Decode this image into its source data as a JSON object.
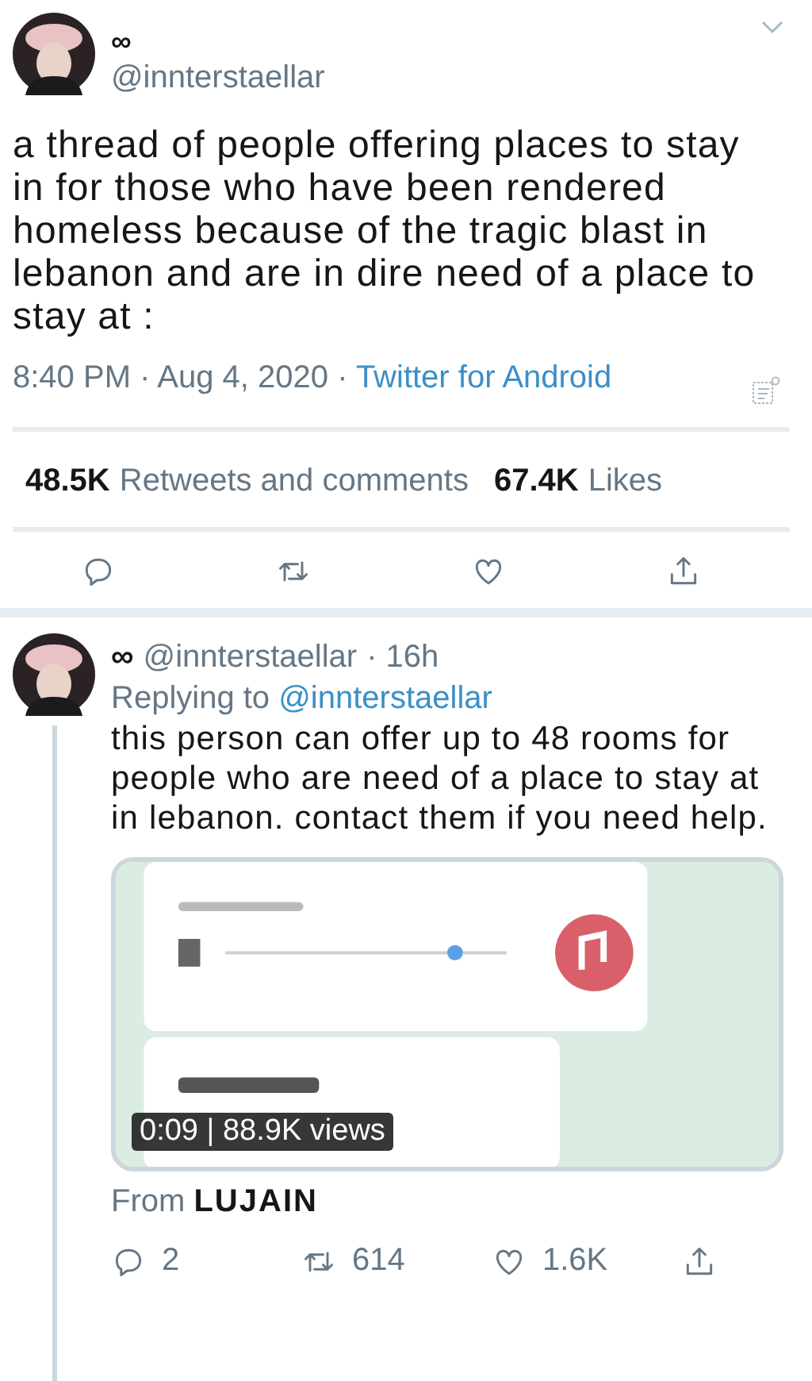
{
  "tweet": {
    "name": "∞",
    "handle": "@innterstaellar",
    "text": "a thread of people offering places to stay in for those who have been rendered homeless because of the tragic blast in lebanon and are in dire need of a place to stay at :",
    "time": "8:40 PM · Aug 4, 2020 · ",
    "source": "Twitter for Android",
    "stats": [
      {
        "count": "48.5K",
        "label": "Retweets and comments"
      },
      {
        "count": "67.4K",
        "label": "Likes"
      }
    ],
    "actions": [
      {
        "kind": "reply"
      },
      {
        "kind": "retweet"
      },
      {
        "kind": "like"
      },
      {
        "kind": "share"
      }
    ]
  },
  "reply": {
    "name": "∞",
    "handle": "@innterstaellar",
    "age": "· 16h",
    "replying_label": "Replying to ",
    "replying_to": "@innterstaellar",
    "text": "this person can offer up to 48 rooms for people who are need of a place to stay at in lebanon. contact them if you need help.",
    "media": {
      "kind": "picture",
      "overlay": "0:09 | 88.9K views"
    },
    "from_label": "From ",
    "from_name": "LUJAIN",
    "actions": [
      {
        "kind": "reply",
        "count": "2"
      },
      {
        "kind": "retweet",
        "count": "614"
      },
      {
        "kind": "like",
        "count": "1.6K"
      },
      {
        "kind": "share"
      }
    ]
  }
}
